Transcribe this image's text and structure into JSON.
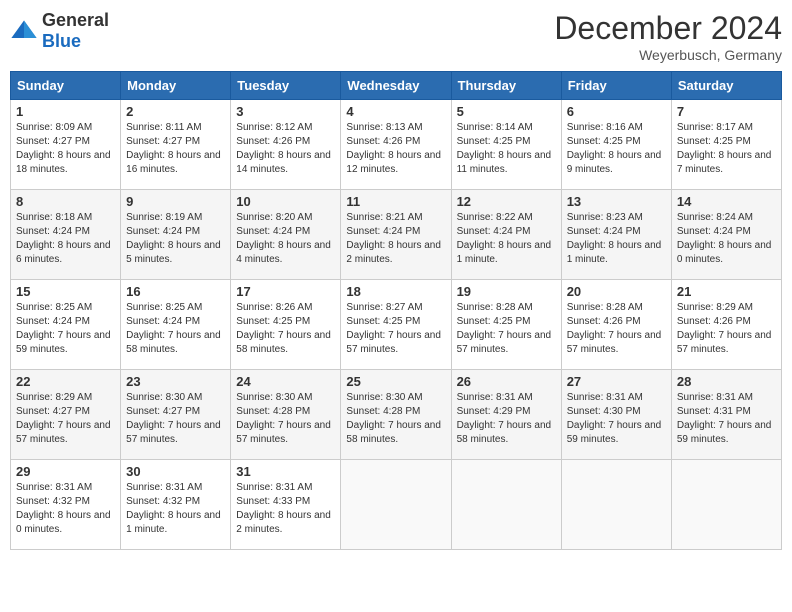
{
  "header": {
    "logo_general": "General",
    "logo_blue": "Blue",
    "month_title": "December 2024",
    "location": "Weyerbusch, Germany"
  },
  "days_of_week": [
    "Sunday",
    "Monday",
    "Tuesday",
    "Wednesday",
    "Thursday",
    "Friday",
    "Saturday"
  ],
  "weeks": [
    [
      {
        "day": "1",
        "sunrise": "8:09 AM",
        "sunset": "4:27 PM",
        "daylight": "8 hours and 18 minutes."
      },
      {
        "day": "2",
        "sunrise": "8:11 AM",
        "sunset": "4:27 PM",
        "daylight": "8 hours and 16 minutes."
      },
      {
        "day": "3",
        "sunrise": "8:12 AM",
        "sunset": "4:26 PM",
        "daylight": "8 hours and 14 minutes."
      },
      {
        "day": "4",
        "sunrise": "8:13 AM",
        "sunset": "4:26 PM",
        "daylight": "8 hours and 12 minutes."
      },
      {
        "day": "5",
        "sunrise": "8:14 AM",
        "sunset": "4:25 PM",
        "daylight": "8 hours and 11 minutes."
      },
      {
        "day": "6",
        "sunrise": "8:16 AM",
        "sunset": "4:25 PM",
        "daylight": "8 hours and 9 minutes."
      },
      {
        "day": "7",
        "sunrise": "8:17 AM",
        "sunset": "4:25 PM",
        "daylight": "8 hours and 7 minutes."
      }
    ],
    [
      {
        "day": "8",
        "sunrise": "8:18 AM",
        "sunset": "4:24 PM",
        "daylight": "8 hours and 6 minutes."
      },
      {
        "day": "9",
        "sunrise": "8:19 AM",
        "sunset": "4:24 PM",
        "daylight": "8 hours and 5 minutes."
      },
      {
        "day": "10",
        "sunrise": "8:20 AM",
        "sunset": "4:24 PM",
        "daylight": "8 hours and 4 minutes."
      },
      {
        "day": "11",
        "sunrise": "8:21 AM",
        "sunset": "4:24 PM",
        "daylight": "8 hours and 2 minutes."
      },
      {
        "day": "12",
        "sunrise": "8:22 AM",
        "sunset": "4:24 PM",
        "daylight": "8 hours and 1 minute."
      },
      {
        "day": "13",
        "sunrise": "8:23 AM",
        "sunset": "4:24 PM",
        "daylight": "8 hours and 1 minute."
      },
      {
        "day": "14",
        "sunrise": "8:24 AM",
        "sunset": "4:24 PM",
        "daylight": "8 hours and 0 minutes."
      }
    ],
    [
      {
        "day": "15",
        "sunrise": "8:25 AM",
        "sunset": "4:24 PM",
        "daylight": "7 hours and 59 minutes."
      },
      {
        "day": "16",
        "sunrise": "8:25 AM",
        "sunset": "4:24 PM",
        "daylight": "7 hours and 58 minutes."
      },
      {
        "day": "17",
        "sunrise": "8:26 AM",
        "sunset": "4:25 PM",
        "daylight": "7 hours and 58 minutes."
      },
      {
        "day": "18",
        "sunrise": "8:27 AM",
        "sunset": "4:25 PM",
        "daylight": "7 hours and 57 minutes."
      },
      {
        "day": "19",
        "sunrise": "8:28 AM",
        "sunset": "4:25 PM",
        "daylight": "7 hours and 57 minutes."
      },
      {
        "day": "20",
        "sunrise": "8:28 AM",
        "sunset": "4:26 PM",
        "daylight": "7 hours and 57 minutes."
      },
      {
        "day": "21",
        "sunrise": "8:29 AM",
        "sunset": "4:26 PM",
        "daylight": "7 hours and 57 minutes."
      }
    ],
    [
      {
        "day": "22",
        "sunrise": "8:29 AM",
        "sunset": "4:27 PM",
        "daylight": "7 hours and 57 minutes."
      },
      {
        "day": "23",
        "sunrise": "8:30 AM",
        "sunset": "4:27 PM",
        "daylight": "7 hours and 57 minutes."
      },
      {
        "day": "24",
        "sunrise": "8:30 AM",
        "sunset": "4:28 PM",
        "daylight": "7 hours and 57 minutes."
      },
      {
        "day": "25",
        "sunrise": "8:30 AM",
        "sunset": "4:28 PM",
        "daylight": "7 hours and 58 minutes."
      },
      {
        "day": "26",
        "sunrise": "8:31 AM",
        "sunset": "4:29 PM",
        "daylight": "7 hours and 58 minutes."
      },
      {
        "day": "27",
        "sunrise": "8:31 AM",
        "sunset": "4:30 PM",
        "daylight": "7 hours and 59 minutes."
      },
      {
        "day": "28",
        "sunrise": "8:31 AM",
        "sunset": "4:31 PM",
        "daylight": "7 hours and 59 minutes."
      }
    ],
    [
      {
        "day": "29",
        "sunrise": "8:31 AM",
        "sunset": "4:32 PM",
        "daylight": "8 hours and 0 minutes."
      },
      {
        "day": "30",
        "sunrise": "8:31 AM",
        "sunset": "4:32 PM",
        "daylight": "8 hours and 1 minute."
      },
      {
        "day": "31",
        "sunrise": "8:31 AM",
        "sunset": "4:33 PM",
        "daylight": "8 hours and 2 minutes."
      },
      null,
      null,
      null,
      null
    ]
  ]
}
